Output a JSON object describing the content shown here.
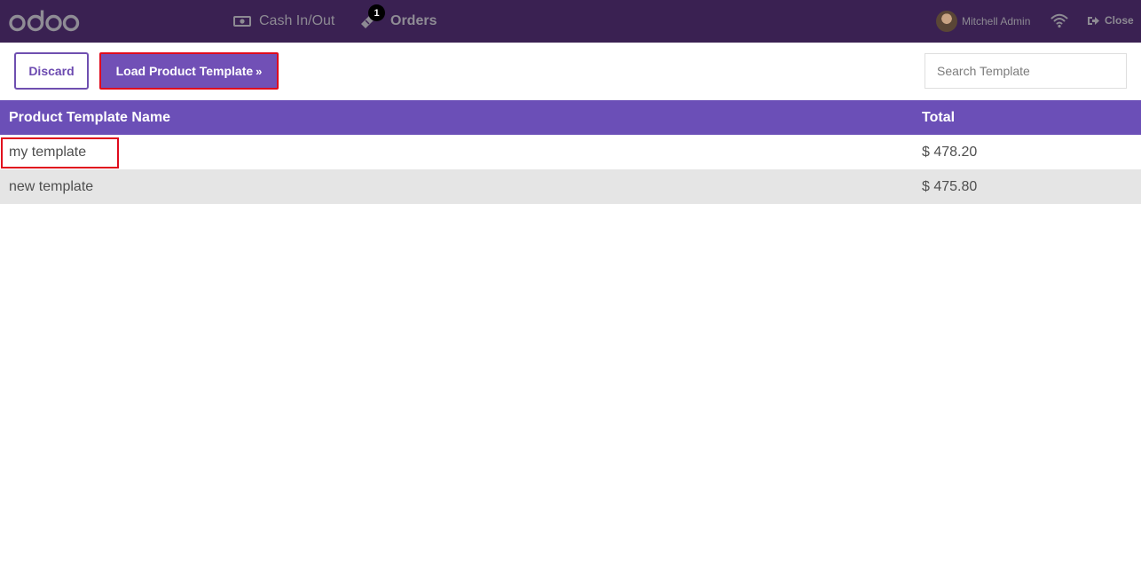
{
  "topbar": {
    "logo": "odoo",
    "cash_label": "Cash In/Out",
    "orders_label": "Orders",
    "orders_badge": "1",
    "user_name": "Mitchell Admin",
    "close_label": "Close",
    "icons": [
      "cash-icon",
      "ticket-icon",
      "avatar",
      "wifi-icon",
      "sign-out-icon"
    ]
  },
  "controls": {
    "discard_label": "Discard",
    "load_label": "Load Product Template",
    "load_chevron": "»",
    "search_placeholder": "Search Template"
  },
  "table": {
    "headers": [
      "Product Template Name",
      "Total"
    ],
    "rows": [
      {
        "name": "my template",
        "total": "$ 478.20"
      },
      {
        "name": "new template",
        "total": "$ 475.80"
      }
    ]
  },
  "colors": {
    "topbar": "#3a2152",
    "accent": "#7150b6",
    "table_header": "#6b4fb7",
    "highlight": "#e00b1d",
    "alt_row": "#e5e5e5"
  }
}
